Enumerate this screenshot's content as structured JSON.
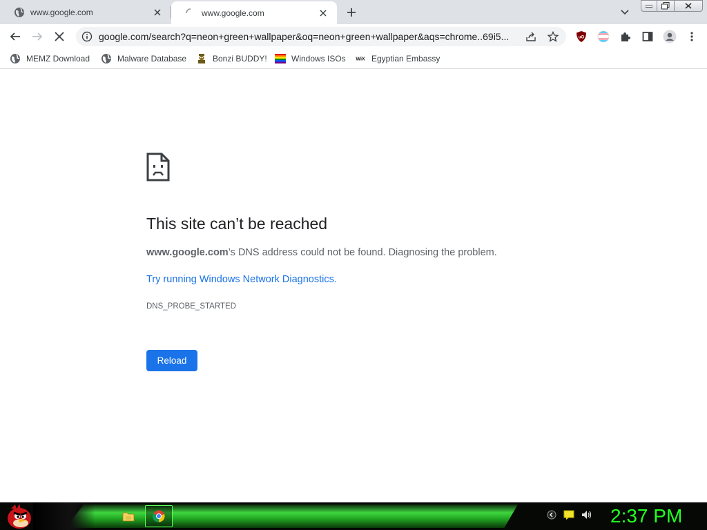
{
  "browser": {
    "tabs": [
      {
        "title": "www.google.com",
        "active": false
      },
      {
        "title": "www.google.com",
        "active": true
      }
    ],
    "address": "google.com/search?q=neon+green+wallpaper&oq=neon+green+wallpaper&aqs=chrome..69i5...",
    "bookmarks": [
      {
        "label": "MEMZ Download",
        "icon": "globe-icon"
      },
      {
        "label": "Malware Database",
        "icon": "globe-icon"
      },
      {
        "label": "Bonzi BUDDY!",
        "icon": "bonzi-icon"
      },
      {
        "label": "Windows ISOs",
        "icon": "rainbow-flag-icon"
      },
      {
        "label": "Egyptian Embassy",
        "icon": "wix-icon"
      }
    ],
    "extensions": [
      "ublock-icon",
      "trans-flag-icon",
      "puzzle-icon",
      "side-panel-icon",
      "profile-icon",
      "menu-icon"
    ]
  },
  "error_page": {
    "title": "This site can’t be reached",
    "host": "www.google.com",
    "desc_rest": "’s DNS address could not be found. Diagnosing the problem.",
    "link": "Try running Windows Network Diagnostics.",
    "code": "DNS_PROBE_STARTED",
    "reload_label": "Reload"
  },
  "taskbar": {
    "clock": "2:37 PM"
  },
  "colors": {
    "accent": "#1a73e8",
    "clock": "#22ff22",
    "taskbar_glow": "#3fd63f"
  }
}
